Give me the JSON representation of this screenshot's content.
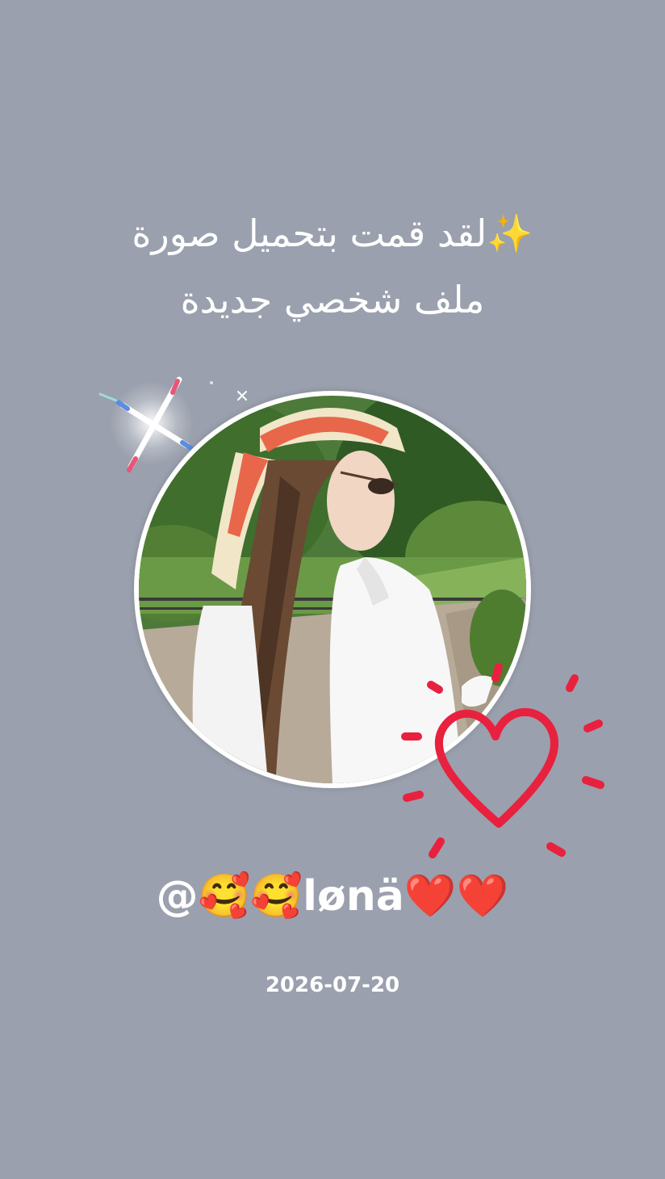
{
  "headline": {
    "line1": "✨لقد قمت بتحميل صورة",
    "line2": "ملف شخصي جديدة"
  },
  "profile": {
    "username": "@🥰🥰lønä❤️❤️",
    "date": "2026-07-20"
  },
  "decorations": {
    "sparkle": "sparkle-icon",
    "heart": "heart-doodle-icon"
  },
  "colors": {
    "background": "#9aa0ad",
    "text": "#ffffff",
    "heart": "#e8213f"
  }
}
